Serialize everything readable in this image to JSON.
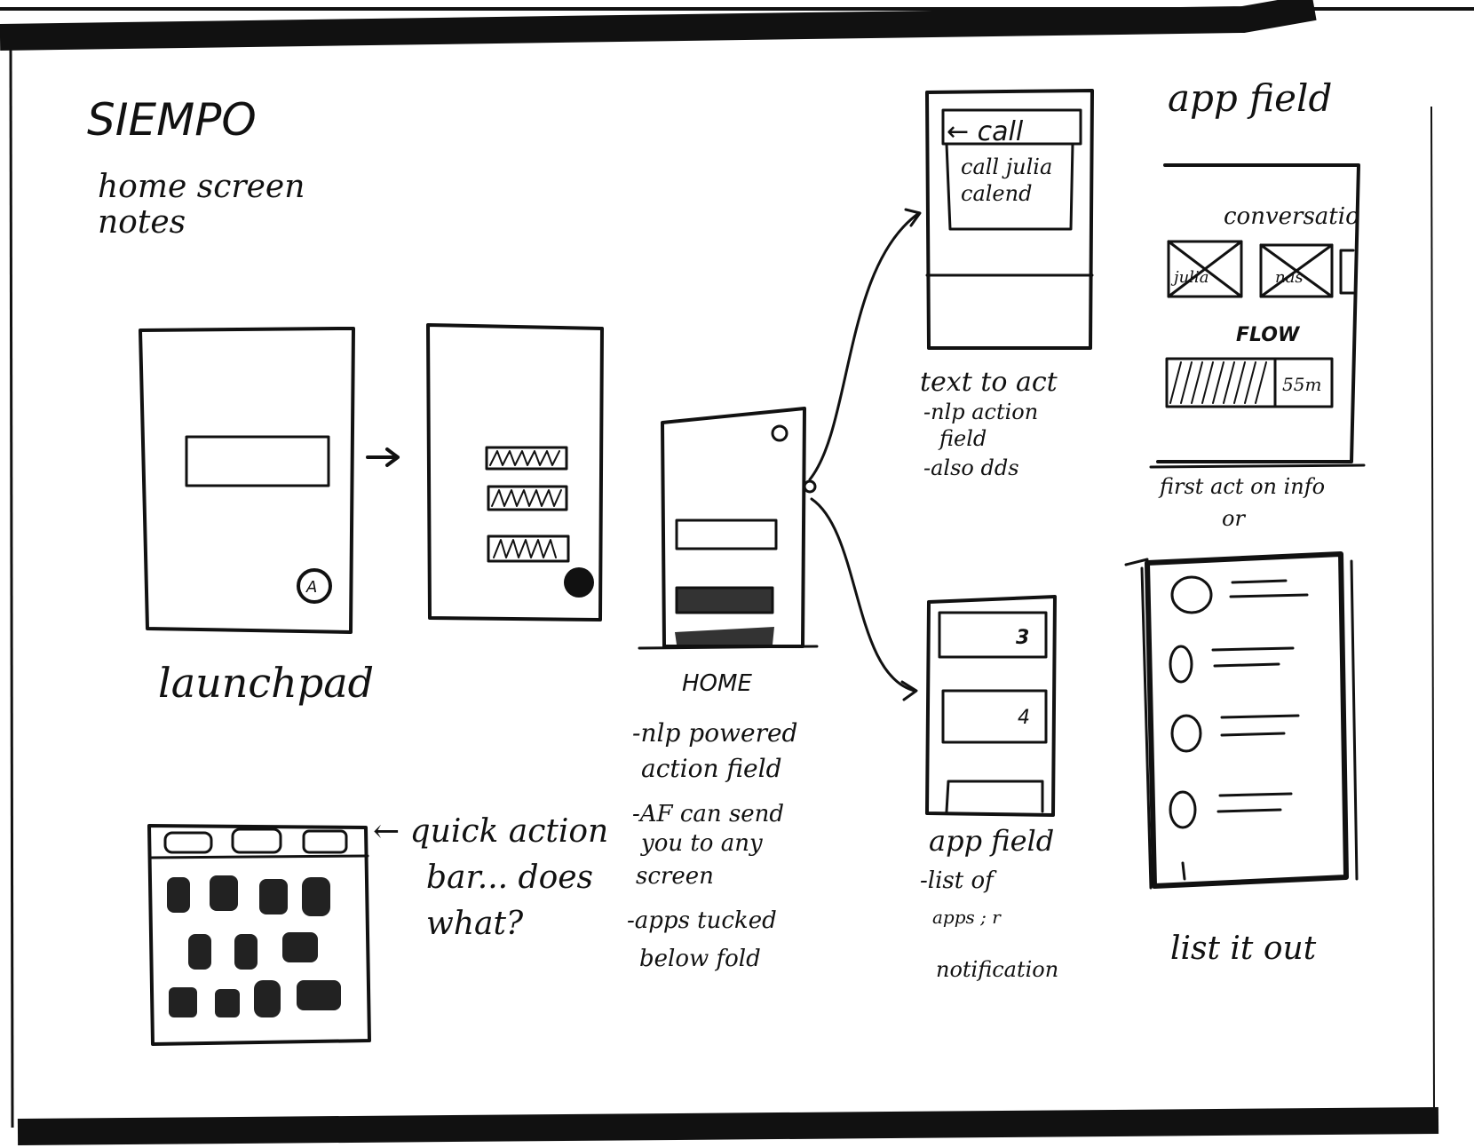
{
  "header": {
    "title": "SIEMPO",
    "subtitle_line1": "home screen",
    "subtitle_line2": "notes"
  },
  "launchpad": {
    "label": "launchpad",
    "fab_letter": "A"
  },
  "home": {
    "label": "HOME",
    "notes": [
      "-nlp powered",
      "action field",
      "-AF can send",
      "you to any",
      "screen",
      "-apps tucked",
      "below fold"
    ]
  },
  "text_to_act": {
    "input_label": "← call",
    "suggestions": [
      "call julia",
      "calend"
    ],
    "notes": [
      "text to act",
      "-nlp action",
      "field",
      "-also dds"
    ]
  },
  "app_field_small": {
    "badges": [
      "3",
      "4"
    ],
    "notes": [
      "app field",
      "-list of",
      "apps ; r",
      "notification"
    ]
  },
  "app_field_large": {
    "title": "app field",
    "conversation_label": "conversatio",
    "avatar_labels": [
      "julia",
      "nas"
    ],
    "flow_label": "FLOW",
    "flow_time": "55m",
    "notes": [
      "first act on info",
      "or"
    ]
  },
  "list_view": {
    "label": "list it out"
  },
  "quick_action": {
    "notes": [
      "← quick action",
      "bar... does",
      "what?"
    ]
  },
  "colors": {
    "ink": "#111111",
    "paper": "#ffffff"
  }
}
